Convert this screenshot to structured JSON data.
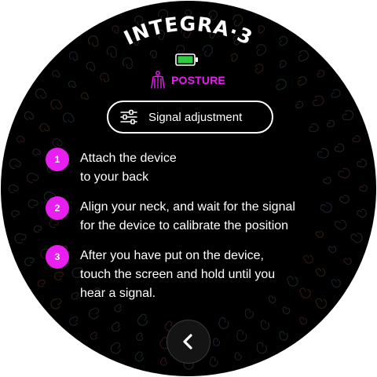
{
  "app": {
    "brand": "INTEGRA·3",
    "battery_icon": "battery-full-icon",
    "battery_color": "#2ecc40"
  },
  "mode": {
    "icon": "posture-body-icon",
    "label": "POSTURE",
    "color": "#e81ff0"
  },
  "signal_button": {
    "icon": "sliders-icon",
    "label": "Signal adjustment"
  },
  "steps": [
    {
      "number": "1",
      "text": "Attach the device\nto your back"
    },
    {
      "number": "2",
      "text": "Align your neck, and wait for the signal\nfor the device to calibrate the position"
    },
    {
      "number": "3",
      "text": "After you have put on the device,\ntouch the screen and hold until you\nhear a signal."
    }
  ],
  "nav": {
    "back_icon": "chevron-left-icon"
  }
}
